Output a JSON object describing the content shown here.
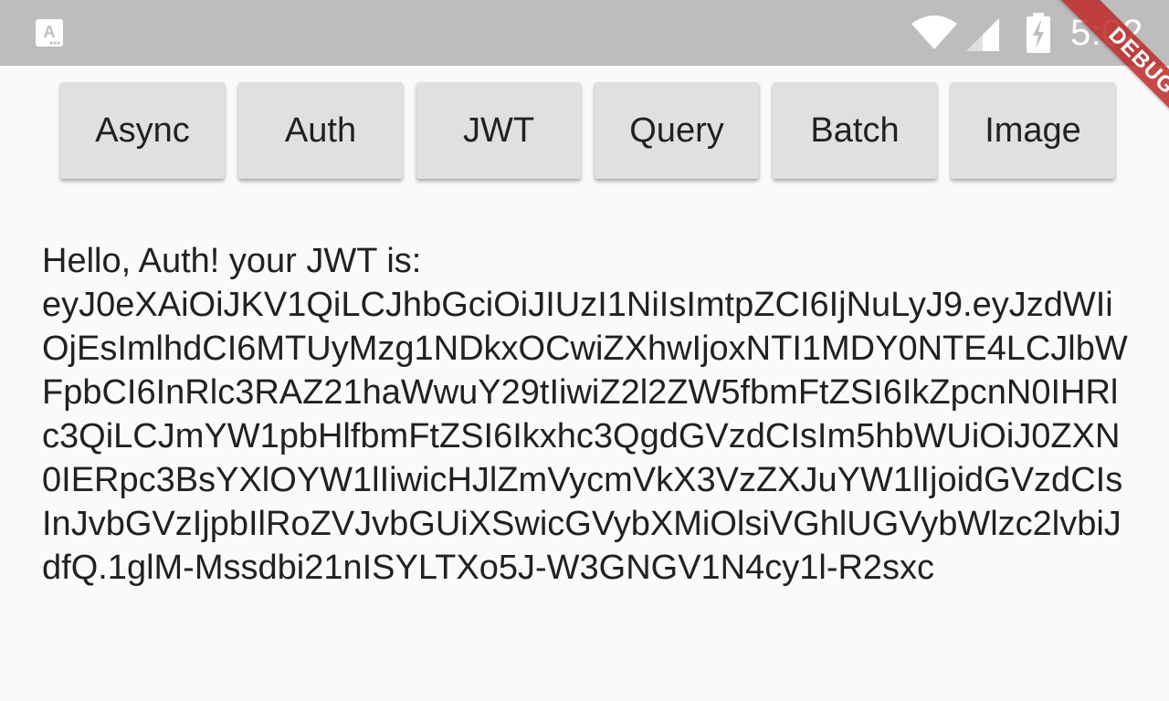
{
  "status_bar": {
    "time": "5:02",
    "icons": [
      "app-notification-icon",
      "wifi-icon",
      "signal-icon",
      "battery-charging-icon"
    ]
  },
  "debug_banner": {
    "label": "DEBUG"
  },
  "buttons": [
    {
      "label": "Async"
    },
    {
      "label": "Auth"
    },
    {
      "label": "JWT"
    },
    {
      "label": "Query"
    },
    {
      "label": "Batch"
    },
    {
      "label": "Image"
    }
  ],
  "content": {
    "greeting": "Hello, Auth! your JWT is:",
    "token": "eyJ0eXAiOiJKV1QiLCJhbGciOiJIUzI1NiIsImtpZCI6IjNuLyJ9.eyJzdWIiOjEsImlhdCI6MTUyMzg1NDkxOCwiZXhwIjoxNTI1MDY0NTE4LCJlbWFpbCI6InRlc3RAZ21haWwuY29tIiwiZ2l2ZW5fbmFtZSI6IkZpcnN0IHRlc3QiLCJmYW1pbHlfbmFtZSI6Ikxhc3QgdGVzdCIsIm5hbWUiOiJ0ZXN0IERpc3BsYXlOYW1lIiwicHJlZmVycmVkX3VzZXJuYW1lIjoidGVzdCIsInJvbGVzIjpbIlRoZVJvbGUiXSwicGVybXMiOlsiVGhlUGVybWlzc2lvbiJdfQ.1glM-Mssdbi21nISYLTXo5J-W3GNGV1N4cy1l-R2sxc"
  },
  "colors": {
    "status_bar": "#bdbdbd",
    "background": "#fafafa",
    "button": "#e0e0e0",
    "text": "#212121",
    "debug_ribbon": "#be2828"
  }
}
